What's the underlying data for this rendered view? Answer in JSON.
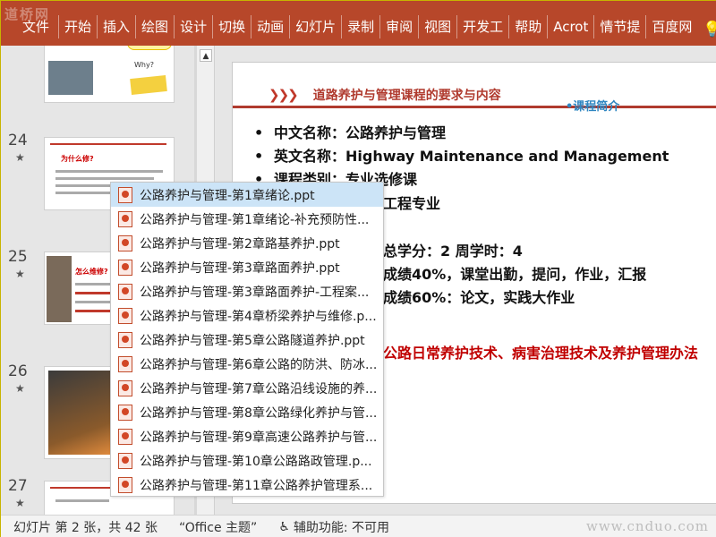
{
  "ribbon": {
    "watermark": "道桥网",
    "tabs": [
      "文件",
      "开始",
      "插入",
      "绘图",
      "设计",
      "切换",
      "动画",
      "幻灯片",
      "录制",
      "审阅",
      "视图",
      "开发工",
      "帮助",
      "Acrot",
      "情节提",
      "百度网"
    ],
    "right_text": "告",
    "accent_color": "#b7472a"
  },
  "thumbnails": [
    {
      "number": "",
      "star": "",
      "mini_title": "Why?"
    },
    {
      "number": "24",
      "star": "★",
      "mini_title": "为什么修?"
    },
    {
      "number": "25",
      "star": "★",
      "mini_title": "怎么维修?"
    },
    {
      "number": "26",
      "star": "★",
      "mini_title": ""
    },
    {
      "number": "27",
      "star": "★",
      "mini_title": ""
    }
  ],
  "slide": {
    "header_title": "道路养护与管理课程的要求与内容",
    "intro_label": "•课程简介",
    "bullets": [
      "中文名称：公路养护与管理",
      "英文名称：Highway Maintenance and Management",
      "课程类别：专业选修课",
      "工程专业"
    ],
    "fragments": [
      "总学分：2  周学时：4",
      "成绩40%，课堂出勤，提问，作业，汇报",
      "成绩60%：论文，实践大作业",
      "公路日常养护技术、病害治理技术及养护管理办法"
    ]
  },
  "dropdown": {
    "items": [
      "公路养护与管理-第1章绪论.ppt",
      "公路养护与管理-第1章绪论-补充预防性...",
      "公路养护与管理-第2章路基养护.ppt",
      "公路养护与管理-第3章路面养护.ppt",
      "公路养护与管理-第3章路面养护-工程案...",
      "公路养护与管理-第4章桥梁养护与维修.p...",
      "公路养护与管理-第5章公路隧道养护.ppt",
      "公路养护与管理-第6章公路的防洪、防冰...",
      "公路养护与管理-第7章公路沿线设施的养...",
      "公路养护与管理-第8章公路绿化养护与管...",
      "公路养护与管理-第9章高速公路养护与管...",
      "公路养护与管理-第10章公路路政管理.p...",
      "公路养护与管理-第11章公路养护管理系..."
    ],
    "selected_index": 0
  },
  "status": {
    "slide_info": "幻灯片 第 2 张，共 42 张",
    "theme": "“Office 主题”",
    "accessibility": "辅助功能: 不可用",
    "brand_watermark": "www.cnduo.com"
  }
}
